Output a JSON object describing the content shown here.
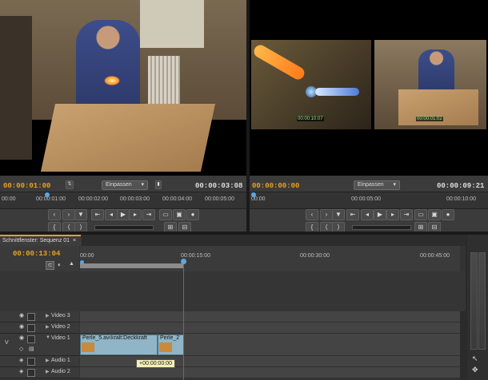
{
  "source_monitor": {
    "timecode_current": "00:00:01:00",
    "timecode_duration": "00:00:03:08",
    "fit_label": "Einpassen",
    "ruler_ticks": [
      "00:00",
      "00:00:01:00",
      "00:00:02:00",
      "00:00:03:00",
      "00:00:04:00",
      "00:00:05:00"
    ]
  },
  "program_monitor": {
    "timecode_current": "00:00:00:00",
    "timecode_duration": "00:00:09:21",
    "fit_label": "Einpassen",
    "overlay_left": "00:00:10:07",
    "overlay_right": "00:00:01:02",
    "ruler_ticks": [
      "00:00",
      "00:00:05:00",
      "00:00:10:00"
    ]
  },
  "timeline": {
    "tab_label": "Schnittfenster: Sequenz 01",
    "timecode": "00:00:13:04",
    "ruler_ticks": [
      "00:00",
      "00:00:15:00",
      "00:00:30:00",
      "00:00:45:00"
    ],
    "tracks": [
      {
        "name": "Video 3"
      },
      {
        "name": "Video 2"
      },
      {
        "name": "Video 1"
      },
      {
        "name": "Audio 1"
      },
      {
        "name": "Audio 2"
      }
    ],
    "target_label": "V",
    "clip1_label": "Perle_5.avi",
    "clip1_effect": "kralt:Deckkraft",
    "clip2_label": "Perle_2",
    "tooltip": "+00:00:00:00"
  }
}
